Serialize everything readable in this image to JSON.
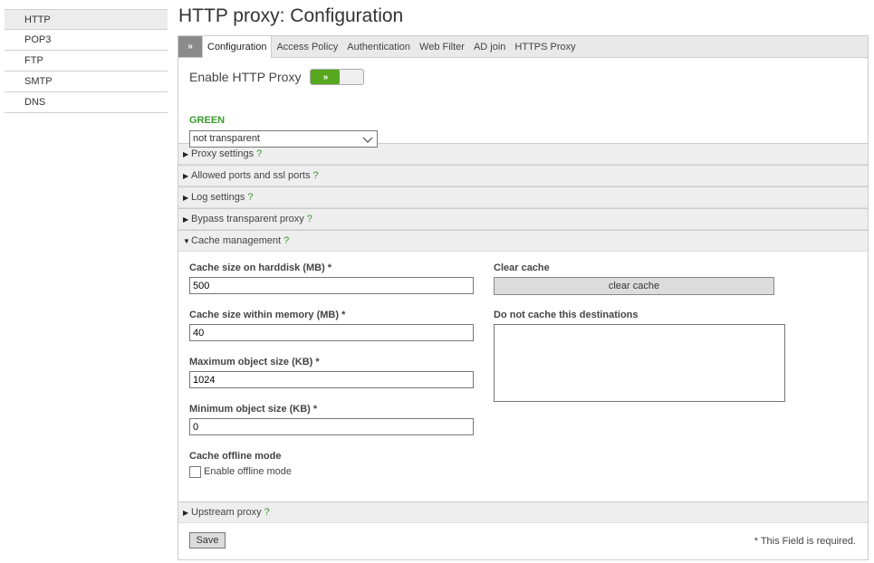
{
  "nav": {
    "items": [
      {
        "label": "HTTP",
        "active": true
      },
      {
        "label": "POP3"
      },
      {
        "label": "FTP"
      },
      {
        "label": "SMTP"
      },
      {
        "label": "DNS"
      }
    ]
  },
  "page_title": "HTTP proxy: Configuration",
  "tabs": {
    "toggle_glyph": "»",
    "items": [
      "Configuration",
      "Access Policy",
      "Authentication",
      "Web Filter",
      "AD join",
      "HTTPS Proxy"
    ]
  },
  "enable": {
    "label": "Enable HTTP Proxy",
    "toggle_glyph": "»",
    "state": "on"
  },
  "zone": {
    "label": "GREEN",
    "mode_value": "not transparent"
  },
  "sections": {
    "proxy_settings": "Proxy settings",
    "allowed_ports": "Allowed ports and ssl ports",
    "log_settings": "Log settings",
    "bypass": "Bypass transparent proxy",
    "cache_management": "Cache management",
    "upstream": "Upstream proxy",
    "help": "?"
  },
  "cache": {
    "harddisk_label": "Cache size on harddisk (MB) *",
    "harddisk_value": "500",
    "memory_label": "Cache size within memory (MB) *",
    "memory_value": "40",
    "max_obj_label": "Maximum object size (KB) *",
    "max_obj_value": "1024",
    "min_obj_label": "Minimum object size (KB) *",
    "min_obj_value": "0",
    "offline_label": "Cache offline mode",
    "offline_checkbox_label": "Enable offline mode",
    "clear_label": "Clear cache",
    "clear_button": "clear cache",
    "no_cache_label": "Do not cache this destinations"
  },
  "footer": {
    "save": "Save",
    "required_note": "* This Field is required."
  },
  "colors": {
    "accent_green": "#58a81f",
    "zone_green": "#3a9a2c"
  }
}
